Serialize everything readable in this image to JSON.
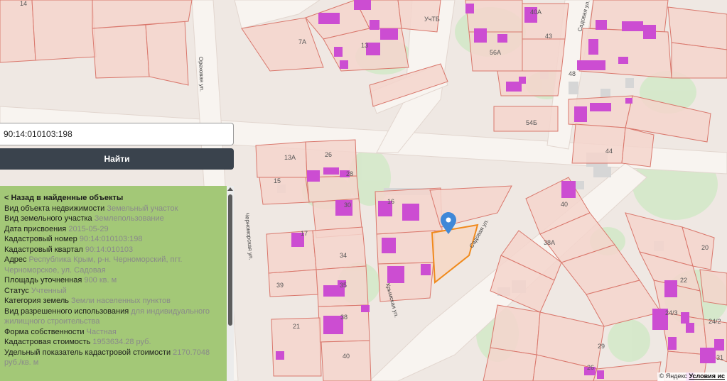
{
  "search": {
    "value": "90:14:010103:198"
  },
  "find_button_label": "Найти",
  "panel": {
    "back_link": "< Назад в найденные объекты",
    "rows": [
      {
        "label": "Вид объекта недвижимости",
        "value": "Земельный участок"
      },
      {
        "label": "Вид земельного участка",
        "value": "Землепользование"
      },
      {
        "label": "Дата присвоения",
        "value": "2015-05-29"
      },
      {
        "label": "Кадастровый номер",
        "value": "90:14:010103:198"
      },
      {
        "label": "Кадастровый квартал",
        "value": "90:14:010103"
      },
      {
        "label": "Адрес",
        "value": "Республика Крым, р-н. Черноморский, пгт. Черноморское, ул. Садовая"
      },
      {
        "label": "Площадь уточненная",
        "value": "900 кв. м"
      },
      {
        "label": "Статус",
        "value": "Учтенный"
      },
      {
        "label": "Категория земель",
        "value": "Земли населенных пунктов"
      },
      {
        "label": "Вид разрешенного использования",
        "value": "для индивидуального жилищного строительства"
      },
      {
        "label": "Форма собственности",
        "value": "Частная"
      },
      {
        "label": "Кадастровая стоимость",
        "value": "1953634.28 руб."
      },
      {
        "label": "Удельный показатель кадастровой стоимости",
        "value": "2170.7048 руб./кв. м"
      }
    ]
  },
  "map": {
    "parcel_labels": [
      "14",
      "7А",
      "13",
      "УчТБ",
      "40А",
      "43",
      "56А",
      "48",
      "54Б",
      "13А",
      "26",
      "28",
      "15",
      "30",
      "16",
      "17",
      "34",
      "39",
      "35",
      "38",
      "21",
      "40",
      "31",
      "44",
      "40",
      "38А",
      "20",
      "22",
      "24/3",
      "24/2",
      "29",
      "26"
    ],
    "streets": [
      "Ореховая ул.",
      "Черноморская ул.",
      "Крымская ул.",
      "Садовая ул.",
      "Садовая ул."
    ],
    "colors": {
      "parcel_fill": "#f5d5cd",
      "parcel_stroke": "#d9776c",
      "building": "#cc4dd2",
      "road": "#f7f2ee",
      "green": "#d7ead0",
      "selected_outline": "#f08a1c",
      "marker": "#3f88d8",
      "panel_bg": "#a3c877",
      "button_bg": "#3a434d"
    }
  },
  "attribution": {
    "prefix": "© Яндекс",
    "link": "Условия ис"
  }
}
